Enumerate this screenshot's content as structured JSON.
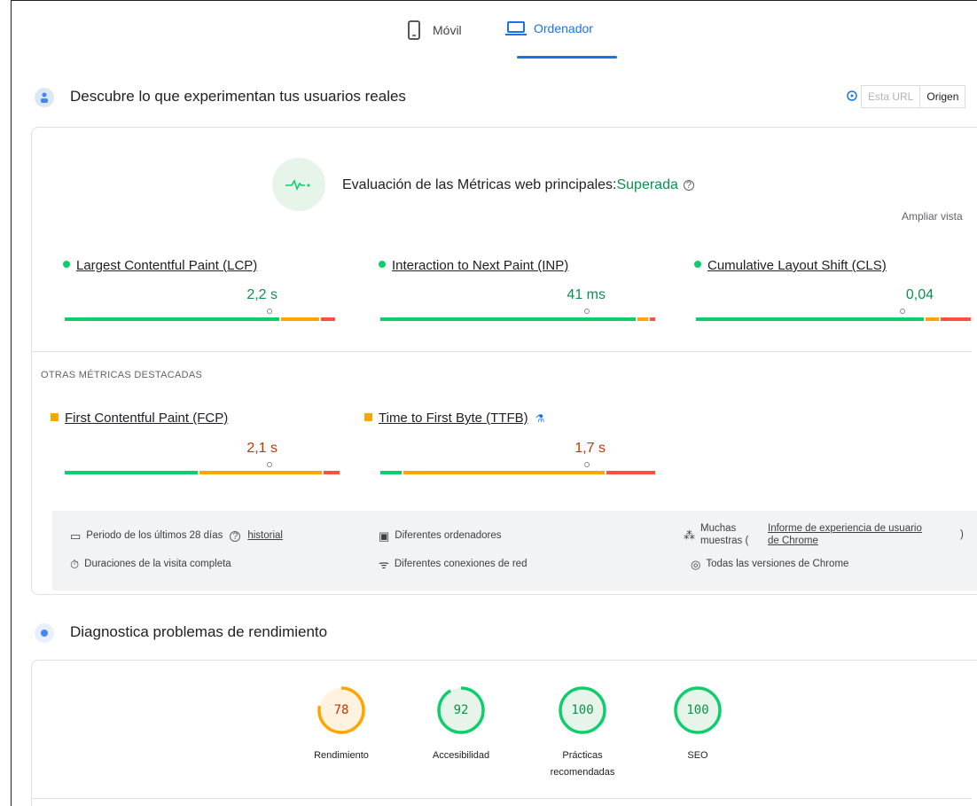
{
  "tabs": [
    {
      "label": "Móvil",
      "icon": "phone-icon",
      "active": false
    },
    {
      "label": "Ordenador",
      "icon": "laptop-icon",
      "active": true
    }
  ],
  "field_section": {
    "title": "Descubre lo que experimentan tus usuarios reales",
    "icon": "users-icon",
    "toggle": {
      "help_icon": "help-circle-icon",
      "options": [
        "Esta URL",
        "Origen"
      ],
      "selected": "Origen"
    }
  },
  "assessment": {
    "label": "Evaluación de las Métricas web principales:",
    "status": "Superada",
    "icon": "pulse-icon",
    "expand_label": "Ampliar vista"
  },
  "core_metrics": [
    {
      "name": "Largest Contentful Paint (LCP)",
      "value": "2,2 s",
      "status": "good",
      "distribution": [
        0.78,
        0.14,
        0.05
      ]
    },
    {
      "name": "Interaction to Next Paint (INP)",
      "value": "41 ms",
      "status": "good",
      "distribution": [
        0.94,
        0.04,
        0.02
      ]
    },
    {
      "name": "Cumulative Layout Shift (CLS)",
      "value": "0,04",
      "status": "good",
      "distribution": [
        0.84,
        0.05,
        0.11
      ]
    }
  ],
  "other_metrics": {
    "title": "OTRAS MÉTRICAS DESTACADAS",
    "items": [
      {
        "name": "First Contentful Paint (FCP)",
        "value": "2,1 s",
        "status": "average",
        "distribution": [
          0.49,
          0.45,
          0.06
        ]
      },
      {
        "name": "Time to First Byte (TTFB)",
        "value": "1,7 s",
        "status": "average",
        "distribution": [
          0.08,
          0.74,
          0.18
        ],
        "experimental_icon": "flask-icon"
      }
    ]
  },
  "footer": {
    "period": "Periodo de los últimos 28 días",
    "history_link": "historial",
    "devices": "Diferentes ordenadores",
    "samples_prefix": "Muchas muestras (",
    "samples_link": "Informe de experiencia de usuario de Chrome",
    "samples_suffix": ")",
    "duration": "Duraciones de la visita completa",
    "networks": "Diferentes conexiones de red",
    "versions": "Todas las versiones de Chrome"
  },
  "diagnostics_section": {
    "title": "Diagnostica problemas de rendimiento",
    "icon": "lab-icon"
  },
  "scores": [
    {
      "label": "Rendimiento",
      "value": "78",
      "fraction": 0.78,
      "color": "#ffa400",
      "text_color": "#c33300"
    },
    {
      "label": "Accesibilidad",
      "value": "92",
      "fraction": 0.92,
      "color": "#0cce6b",
      "text_color": "#0d904f"
    },
    {
      "label": "Prácticas recomendadas",
      "value": "100",
      "fraction": 1.0,
      "color": "#0cce6b",
      "text_color": "#0d904f"
    },
    {
      "label": "SEO",
      "value": "100",
      "fraction": 1.0,
      "color": "#0cce6b",
      "text_color": "#0d904f"
    }
  ],
  "colors": {
    "good": "#0cce6b",
    "average": "#ffa400",
    "poor": "#ff4e42",
    "accent": "#1a73e8"
  }
}
